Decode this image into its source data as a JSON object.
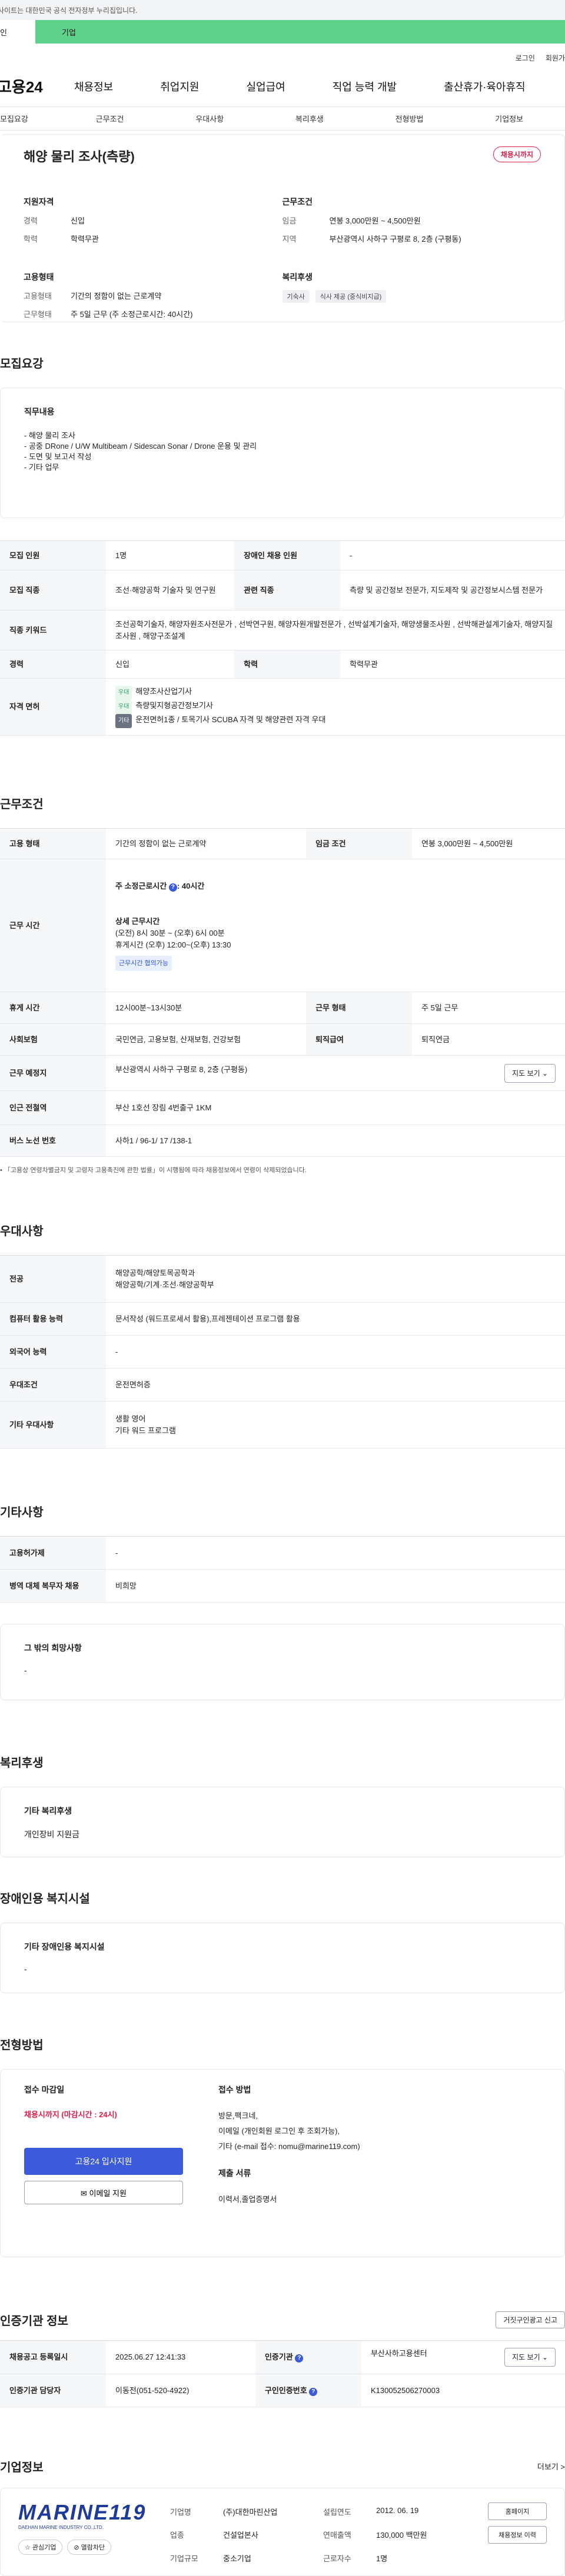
{
  "topbar": {
    "notice": "사이트는 대한민국 공식 전자정부 누리집입니다."
  },
  "tabs": {
    "user": "인",
    "corp": "기업"
  },
  "util": {
    "login": "로그인",
    "join": "회원가"
  },
  "gnb": {
    "logo": "고용24",
    "items": [
      "채용정보",
      "취업지원",
      "실업급여",
      "직업 능력 개발",
      "출산휴가·육아휴직"
    ]
  },
  "subnav": [
    "모집요강",
    "근무조건",
    "우대사항",
    "복리후생",
    "전형방법",
    "기업정보"
  ],
  "summary": {
    "title": "해양 물리 조사(측량)",
    "status": "채용시까지",
    "qual_title": "지원자격",
    "career_k": "경력",
    "career_v": "신입",
    "edu_k": "학력",
    "edu_v": "학력무관",
    "cond_title": "근무조건",
    "wage_k": "임금",
    "wage_v": "연봉 3,000만원 ~ 4,500만원",
    "region_k": "지역",
    "region_v": "부산광역시 사하구 구평로 8, 2층 (구평동)",
    "emp_title": "고용형태",
    "emp_k": "고용형태",
    "emp_v": "기간의 정함이 없는 근로계약",
    "work_k": "근무형태",
    "work_v": "주 5일 근무 (주 소정근로시간: 40시간)",
    "welfare_title": "복리후생",
    "welfare_chips": [
      "기숙사",
      "식사 제공 (중식비지급)"
    ]
  },
  "recruit": {
    "section_title": "모집요강",
    "duty_title": "직무내용",
    "duty_lines": [
      "- 해양 물리 조사",
      "- 공중 DRone / U/W Multibeam / Sidescan Sonar / Drone 운용 및 관리",
      "- 도면 및 보고서 작성",
      "- 기타 업무"
    ],
    "rows": {
      "headcount_k": "모집 인원",
      "headcount_v": "1명",
      "disabled_k": "장애인 채용 인원",
      "disabled_v": "-",
      "job_k": "모집 직종",
      "job_v": "조선·해양공학 기술자 및 연구원",
      "rel_k": "관련 직종",
      "rel_v": "측량 및 공간정보 전문가, 지도제작 및 공간정보시스템 전문가",
      "keyword_k": "직종 키워드",
      "keyword_v": "조선공학기술자, 해양자원조사전문가 , 선박연구원, 해양자원개발전문가 , 선박설계기술자, 해양생물조사원 , 선박해관설계기술자, 해양지질조사원 , 해양구조설계",
      "career_k": "경력",
      "career_v": "신입",
      "edu_k": "학력",
      "edu_v": "학력무관",
      "license_k": "자격 면허",
      "licenses": [
        {
          "tag": "우대",
          "name": "해양조사산업기사"
        },
        {
          "tag": "우대",
          "name": "측량및지형공간정보기사"
        },
        {
          "tag": "기타",
          "name": "운전면허1종 / 토목기사 SCUBA 자격 및 해양관련 자격 우대"
        }
      ]
    }
  },
  "work": {
    "section_title": "근무조건",
    "emp_k": "고용 형태",
    "emp_v": "기간의 정함이 없는 근로계약",
    "wage_k": "임금 조건",
    "wage_v": "연봉 3,000만원 ~ 4,500만원",
    "hours_k": "근무 시간",
    "hours_weekly": "주 소정근로시간 ",
    "hours_weekly_v": ": 40시간",
    "hours_detail_title": "상세 근무시간",
    "hours_detail_1": "(오전) 8시 30분 ~ (오후) 6시 00분",
    "hours_detail_2": "휴게시간 (오후) 12:00~(오후) 13:30",
    "flex_tag": "근무시간 협의가능",
    "rest_k": "휴게 시간",
    "rest_v": "12시00분~13시30분",
    "type_k": "근무 형태",
    "type_v": "주 5일 근무",
    "ins_k": "사회보험",
    "ins_v": "국민연금, 고용보험, 산재보험, 건강보험",
    "sev_k": "퇴직급여",
    "sev_v": "퇴직연금",
    "place_k": "근무 예정지",
    "place_v": "부산광역시 사하구 구평로 8, 2층 (구평동)",
    "map_btn": "지도 보기 ⌄",
    "subway_k": "인근 전철역",
    "subway_v": "부산 1호선 장림 4번출구 1KM",
    "bus_k": "버스 노선 번호",
    "bus_v": "사하1 / 96-1/ 17 /138-1",
    "note": "• 「고용상 연령차별금지 및 고령자 고용촉진에 관한 법률」이 시행됨에 따라 채용정보에서 연령이 삭제되었습니다."
  },
  "pref": {
    "section_title": "우대사항",
    "major_k": "전공",
    "major_v1": "해양공학/해양토목공학과",
    "major_v2": "해양공학/기계·조선·해양공학부",
    "pc_k": "컴퓨터 활용 능력",
    "pc_v": "문서작성 (워드프로세서 활용),프레젠테이션 프로그램 활용",
    "lang_k": "외국어 능력",
    "lang_v": "-",
    "cond_k": "우대조건",
    "cond_v": "운전면허증",
    "etc_k": "기타 우대사항",
    "etc_v1": "생활 영어",
    "etc_v2": "기타 워드 프로그램"
  },
  "etc": {
    "section_title": "기타사항",
    "hire_k": "고용허가제",
    "hire_v": "-",
    "military_k": "병역 대체 복무자 채용",
    "military_v": "비희망",
    "wish_title": "그 밖의 희망사항",
    "wish_v": "-"
  },
  "welfare": {
    "section_title": "복리후생",
    "title": "기타 복리후생",
    "value": "개인장비 지원금"
  },
  "disability": {
    "section_title": "장애인용 복지시설",
    "title": "기타 장애인용 복지시설",
    "value": "-"
  },
  "apply": {
    "section_title": "전형방법",
    "deadline_title": "접수 마감일",
    "deadline_v": "채용시까지 (마감시간 : 24시)",
    "btn_apply": "고용24 입사지원",
    "btn_mail": "✉ 이메일 지원",
    "method_title": "접수 방법",
    "method_lines": [
      "방문,팩크네,",
      "이메일 (개인회원 로그인 후 조회가능),",
      "기타 (e-mail 접수: nomu@marine119.com)"
    ],
    "docs_title": "제출 서류",
    "docs_v": "이력서,졸업증명서"
  },
  "agency": {
    "section_title": "인증기관 정보",
    "report_btn": "거짓구인광고 신고",
    "reg_k": "채용공고 등록일시",
    "reg_v": "2025.06.27 12:41:33",
    "agency_k": "인증기관",
    "agency_v": "부산사하고용센터",
    "map_btn": "지도 보기 ⌄",
    "mgr_k": "인증기관 담당자",
    "mgr_v": "이동전(051-520-4922)",
    "no_k": "구인인증번호",
    "no_v": "K130052506270003"
  },
  "corp": {
    "section_title": "기업정보",
    "more": "더보기 >",
    "logo_text": "MARINE119",
    "logo_sub": "DAEHAN MARINE INDUSTRY CO.,LTD.",
    "btn_fav": "☆ 관심기업",
    "btn_block": "⊘ 열람차단",
    "name_k": "기업명",
    "name_v": "(주)대한마린산업",
    "founded_k": "설립연도",
    "founded_v": "2012. 06. 19",
    "biz_k": "업종",
    "biz_v": "건설업본사",
    "sales_k": "연매출액",
    "sales_v": "130,000 백만원",
    "size_k": "기업규모",
    "size_v": "중소기업",
    "emp_k": "근로자수",
    "emp_v": "1명",
    "btn_home": "홈페이지",
    "btn_jobs": "채용정보 이력"
  }
}
